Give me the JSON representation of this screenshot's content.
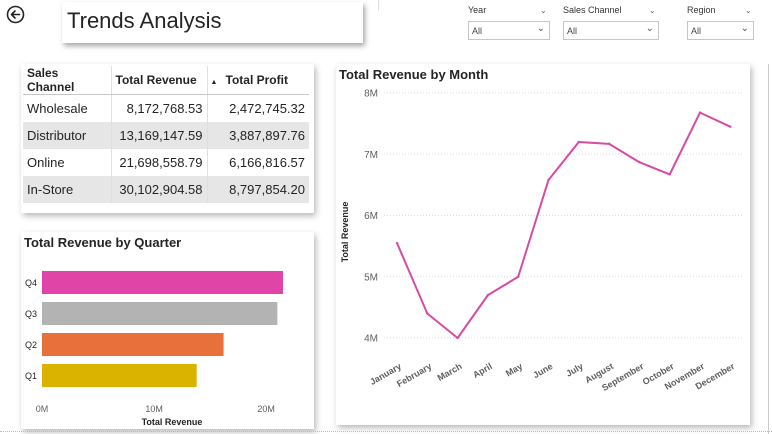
{
  "header": {
    "title": "Trends Analysis",
    "back_icon": "back-arrow-icon"
  },
  "slicers": [
    {
      "label": "Year",
      "value": "All"
    },
    {
      "label": "Sales Channel",
      "value": "All"
    },
    {
      "label": "Region",
      "value": "All"
    }
  ],
  "table": {
    "columns": [
      "Sales Channel",
      "Total Revenue",
      "Total Profit"
    ],
    "rows": [
      [
        "Wholesale",
        "8,172,768.53",
        "2,472,745.32"
      ],
      [
        "Distributor",
        "13,169,147.59",
        "3,887,897.76"
      ],
      [
        "Online",
        "21,698,558.79",
        "6,166,816.57"
      ],
      [
        "In-Store",
        "30,102,904.58",
        "8,797,854.20"
      ]
    ]
  },
  "quarter_chart": {
    "title": "Total Revenue by Quarter",
    "xlabel": "Total Revenue",
    "ticks": [
      "0M",
      "10M",
      "20M"
    ],
    "chart_data": {
      "type": "bar",
      "orientation": "horizontal",
      "categories": [
        "Q4",
        "Q3",
        "Q2",
        "Q1"
      ],
      "values": [
        21.5,
        21.0,
        16.2,
        13.8
      ],
      "colors": [
        "#e044a7",
        "#b3b3b3",
        "#e8703a",
        "#d9b300"
      ],
      "xlabel": "Total Revenue",
      "xlim": [
        0,
        24
      ]
    }
  },
  "month_chart": {
    "title": "Total Revenue by Month",
    "ylabel": "Total Revenue",
    "yticks": [
      "8M",
      "7M",
      "6M",
      "5M",
      "4M"
    ],
    "chart_data": {
      "type": "line",
      "categories": [
        "January",
        "February",
        "March",
        "April",
        "May",
        "June",
        "July",
        "August",
        "September",
        "October",
        "November",
        "December"
      ],
      "values": [
        5.55,
        4.4,
        4.0,
        4.7,
        5.0,
        6.58,
        7.2,
        7.17,
        6.87,
        6.67,
        7.68,
        7.45
      ],
      "color": "#d64ba6",
      "ylabel": "Total Revenue",
      "ylim": [
        4,
        8
      ],
      "grid": true
    }
  }
}
